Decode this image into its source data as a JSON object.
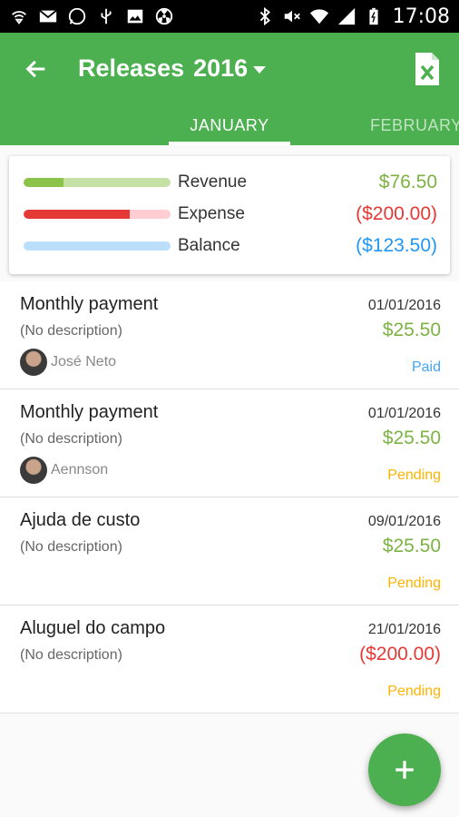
{
  "status_bar": {
    "time": "17:08",
    "icons": [
      "wifi-hotspot-icon",
      "mail-icon",
      "whatsapp-icon",
      "usb-icon",
      "gallery-icon",
      "radiation-icon",
      "bluetooth-icon",
      "mute-icon",
      "wifi-icon",
      "signal-icon",
      "battery-icon"
    ]
  },
  "app_bar": {
    "title": "Releases",
    "year": "2016",
    "back_icon": "arrow-back-icon",
    "action_icon": "excel-export-icon"
  },
  "tabs": [
    {
      "label": "JANUARY",
      "selected": true
    },
    {
      "label": "FEBRUARY",
      "selected": false
    }
  ],
  "summary": [
    {
      "label": "Revenue",
      "amount": "$76.50",
      "fill": 0.27,
      "color": "#8bc34a",
      "track": "#c5e1a5",
      "amount_color": "#7cb342"
    },
    {
      "label": "Expense",
      "amount": "($200.00)",
      "fill": 0.72,
      "color": "#e53935",
      "track": "#ffcdd2",
      "amount_color": "#e53935"
    },
    {
      "label": "Balance",
      "amount": "($123.50)",
      "fill": 0.0,
      "color": "#2196f3",
      "track": "#bbdefb",
      "amount_color": "#2196f3"
    }
  ],
  "releases": [
    {
      "title": "Monthly payment",
      "date": "01/01/2016",
      "description": "(No description)",
      "amount": "$25.50",
      "amount_color": "#7cb342",
      "user": "José Neto",
      "status": "Paid",
      "status_color": "#42a5f5"
    },
    {
      "title": "Monthly payment",
      "date": "01/01/2016",
      "description": "(No description)",
      "amount": "$25.50",
      "amount_color": "#7cb342",
      "user": "Aennson",
      "status": "Pending",
      "status_color": "#ffb300"
    },
    {
      "title": "Ajuda de custo",
      "date": "09/01/2016",
      "description": "(No description)",
      "amount": "$25.50",
      "amount_color": "#7cb342",
      "user": "",
      "status": "Pending",
      "status_color": "#ffb300"
    },
    {
      "title": "Aluguel do campo",
      "date": "21/01/2016",
      "description": "(No description)",
      "amount": "($200.00)",
      "amount_color": "#e53935",
      "user": "",
      "status": "Pending",
      "status_color": "#ffb300"
    }
  ],
  "fab": {
    "icon": "add-icon"
  },
  "colors": {
    "primary": "#4caf50"
  }
}
